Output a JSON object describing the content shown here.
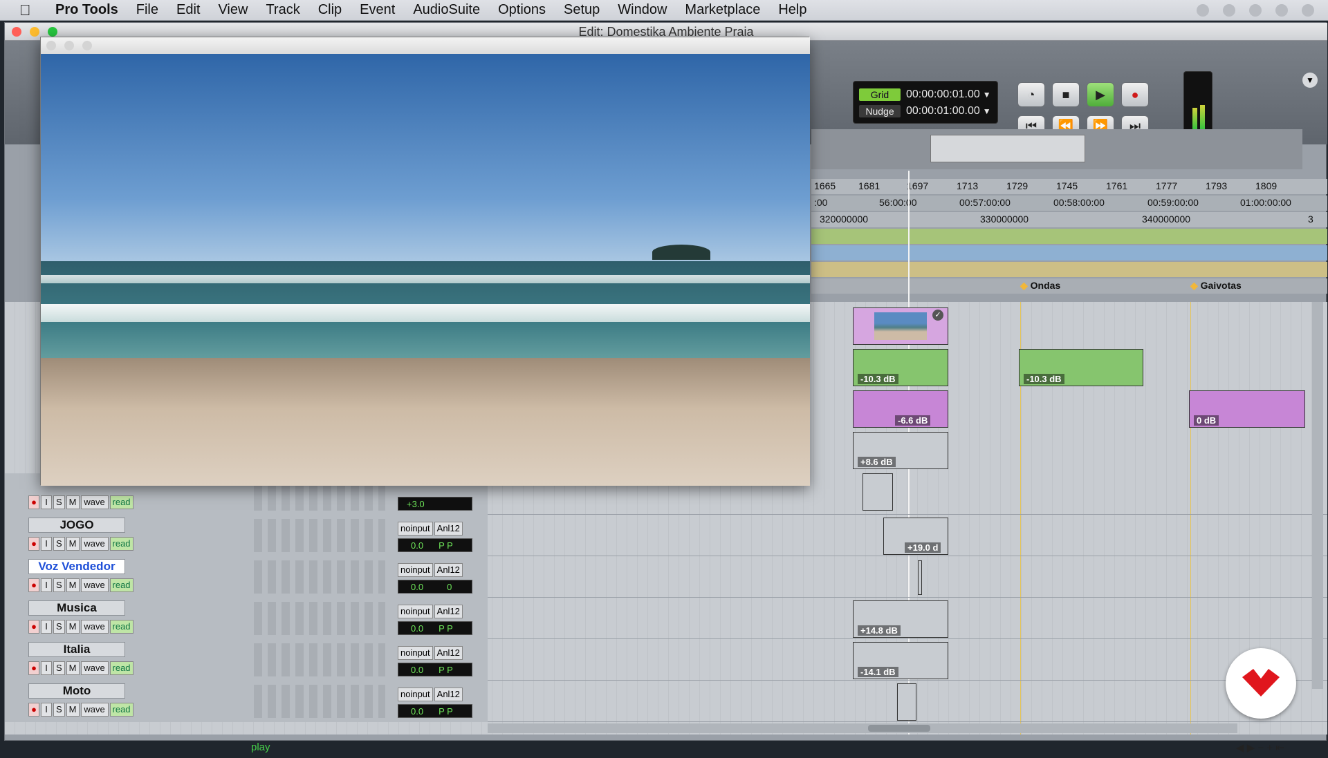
{
  "menubar": {
    "app": "Pro Tools",
    "items": [
      "File",
      "Edit",
      "View",
      "Track",
      "Clip",
      "Event",
      "AudioSuite",
      "Options",
      "Setup",
      "Window",
      "Marketplace",
      "Help"
    ]
  },
  "window": {
    "title": "Edit: Domestika Ambiente Praia"
  },
  "counters": {
    "grid_label": "Grid",
    "grid_value": "00:00:00:01.00",
    "nudge_label": "Nudge",
    "nudge_value": "00:00:01:00.00"
  },
  "rulers": {
    "bars": [
      "1665",
      "1681",
      "1697",
      "1713",
      "1729",
      "1745",
      "1761",
      "1777",
      "1793",
      "1809"
    ],
    "timecode": [
      ":00",
      "56:00:00",
      "00:57:00:00",
      "00:58:00:00",
      "00:59:00:00",
      "01:00:00:00"
    ],
    "samples": [
      "320000000",
      "330000000",
      "340000000",
      "3"
    ],
    "markers": [
      "Ondas",
      "Gaivotas"
    ]
  },
  "tracks": [
    {
      "name": "JOGO",
      "input": "noinput",
      "output": "Anl12",
      "vol": "0.0",
      "pan": "P P",
      "clip": "+19.0 d"
    },
    {
      "name": "Voz Vendedor",
      "input": "noinput",
      "output": "Anl12",
      "vol": "0.0",
      "pan": "0",
      "clip": ""
    },
    {
      "name": "Musica",
      "input": "noinput",
      "output": "Anl12",
      "vol": "0.0",
      "pan": "P P",
      "clip": "+14.8 dB"
    },
    {
      "name": "Italia",
      "input": "noinput",
      "output": "Anl12",
      "vol": "0.0",
      "pan": "P P",
      "clip": "-14.1 dB"
    },
    {
      "name": "Moto",
      "input": "noinput",
      "output": "Anl12",
      "vol": "0.0",
      "pan": "P P",
      "clip": ""
    }
  ],
  "track_buttons": {
    "i": "I",
    "s": "S",
    "m": "M",
    "wave": "wave",
    "read": "read"
  },
  "partial_track": {
    "vol": "+3.0"
  },
  "clips_upper": [
    "-10.3 dB",
    "-10.3 dB",
    "-6.6 dB",
    "0 dB",
    "+8.6 dB"
  ],
  "status": {
    "play": "play"
  },
  "colors": {
    "green_clip": "#86c56e",
    "purple_clip": "#c786d6",
    "video_clip": "#d6a6e0",
    "marker": "#f1b73a"
  }
}
